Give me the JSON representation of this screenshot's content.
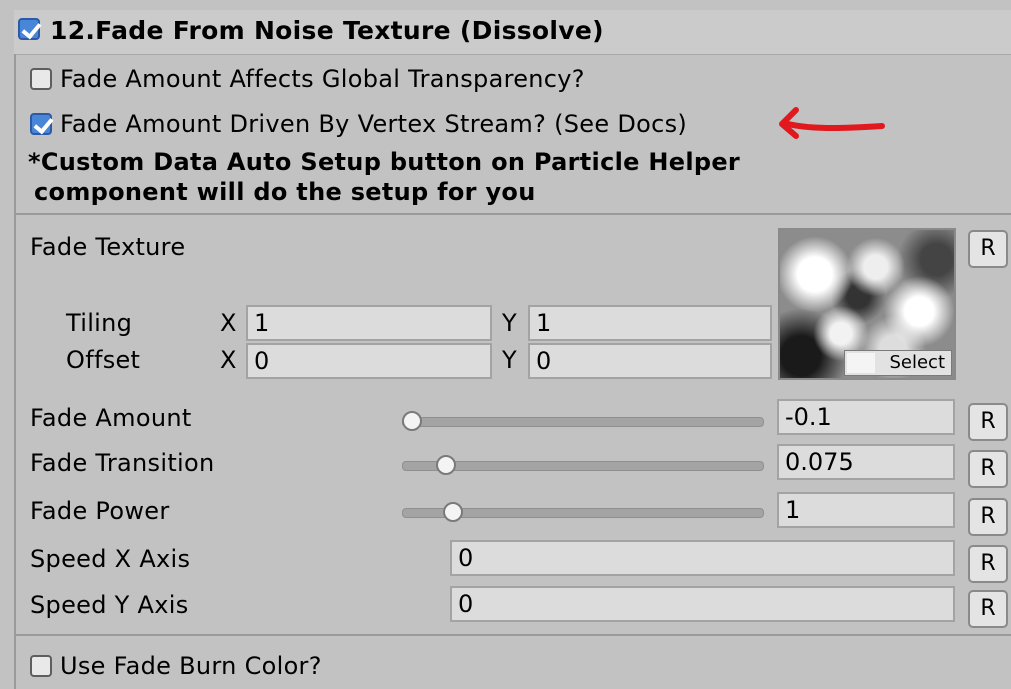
{
  "header": {
    "title": "12.Fade From Noise Texture (Dissolve)",
    "enabled": true
  },
  "options": {
    "global_transparency": {
      "label": "Fade Amount Affects Global Transparency?",
      "checked": false
    },
    "vertex_stream": {
      "label": "Fade Amount Driven By Vertex Stream? (See Docs)",
      "checked": true
    },
    "note_line1": "*Custom Data Auto Setup button on Particle Helper",
    "note_line2": "component will do the setup for you"
  },
  "fade_texture": {
    "label": "Fade Texture",
    "tiling_label": "Tiling",
    "offset_label": "Offset",
    "x_label": "X",
    "y_label": "Y",
    "tiling_x": "1",
    "tiling_y": "1",
    "offset_x": "0",
    "offset_y": "0",
    "select_label": "Select",
    "reset_label": "R"
  },
  "sliders": [
    {
      "label": "Fade Amount",
      "value": "-0.1",
      "fraction": 0.0
    },
    {
      "label": "Fade Transition",
      "value": "0.075",
      "fraction": 0.1
    },
    {
      "label": "Fade Power",
      "value": "1",
      "fraction": 0.12
    }
  ],
  "speed": [
    {
      "label": "Speed X Axis",
      "value": "0"
    },
    {
      "label": "Speed Y Axis",
      "value": "0"
    }
  ],
  "reset_label": "R",
  "burn_color": {
    "label": "Use Fade Burn Color?",
    "checked": false
  },
  "annotation": {
    "color": "#e0191e",
    "icon": "red-arrow-icon"
  }
}
